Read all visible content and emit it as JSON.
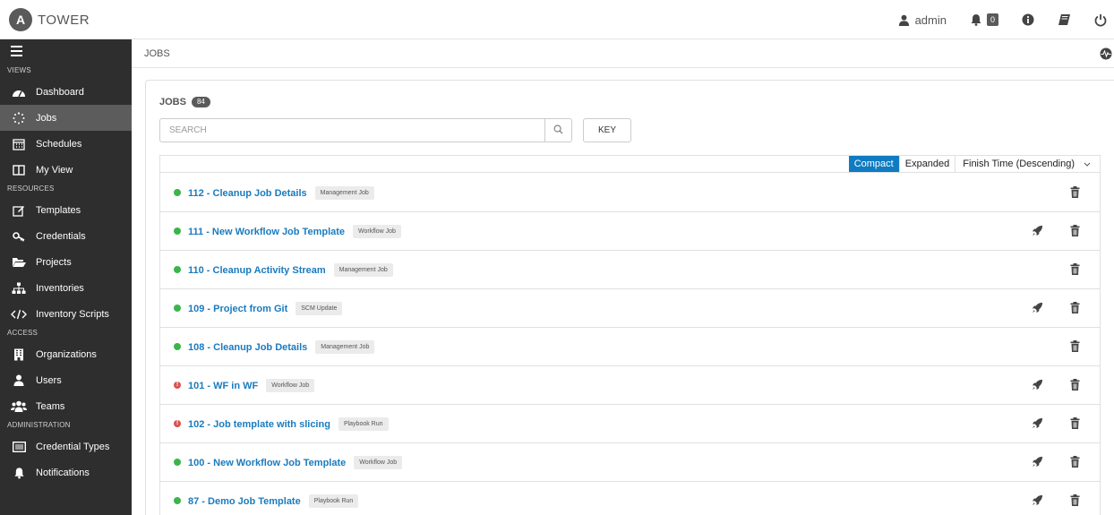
{
  "header": {
    "brand_letter": "A",
    "brand_name": "TOWER",
    "username": "admin",
    "notification_count": "0",
    "icons": [
      "user-icon",
      "bell-icon",
      "info-icon",
      "book-icon",
      "power-icon"
    ]
  },
  "sidebar": {
    "sections": [
      {
        "label": "VIEWS",
        "items": [
          {
            "label": "Dashboard",
            "icon": "dashboard-icon"
          },
          {
            "label": "Jobs",
            "icon": "spinner-icon",
            "active": true
          },
          {
            "label": "Schedules",
            "icon": "calendar-icon"
          },
          {
            "label": "My View",
            "icon": "columns-icon"
          }
        ]
      },
      {
        "label": "RESOURCES",
        "items": [
          {
            "label": "Templates",
            "icon": "pencil-square-icon"
          },
          {
            "label": "Credentials",
            "icon": "key-icon"
          },
          {
            "label": "Projects",
            "icon": "folder-open-icon"
          },
          {
            "label": "Inventories",
            "icon": "sitemap-icon"
          },
          {
            "label": "Inventory Scripts",
            "icon": "code-icon"
          }
        ]
      },
      {
        "label": "ACCESS",
        "items": [
          {
            "label": "Organizations",
            "icon": "building-icon"
          },
          {
            "label": "Users",
            "icon": "user-icon"
          },
          {
            "label": "Teams",
            "icon": "users-icon"
          }
        ]
      },
      {
        "label": "ADMINISTRATION",
        "items": [
          {
            "label": "Credential Types",
            "icon": "list-alt-icon"
          },
          {
            "label": "Notifications",
            "icon": "bell-icon"
          }
        ]
      }
    ]
  },
  "breadcrumb": {
    "current": "JOBS"
  },
  "panel": {
    "title": "JOBS",
    "count": "84",
    "search_placeholder": "SEARCH",
    "key_label": "KEY",
    "view_compact": "Compact",
    "view_expanded": "Expanded",
    "sort_label": "Finish Time (Descending)",
    "colors": {
      "accent": "#0f7bc2",
      "link": "#1a7bbf",
      "success": "#3bb54a",
      "failed": "#d9534f"
    }
  },
  "jobs": [
    {
      "name": "112 - Cleanup Job Details",
      "type": "Management Job",
      "status": "successful",
      "relaunch": false
    },
    {
      "name": "111 - New Workflow Job Template",
      "type": "Workflow Job",
      "status": "successful",
      "relaunch": true
    },
    {
      "name": "110 - Cleanup Activity Stream",
      "type": "Management Job",
      "status": "successful",
      "relaunch": false
    },
    {
      "name": "109 - Project from Git",
      "type": "SCM Update",
      "status": "successful",
      "relaunch": true
    },
    {
      "name": "108 - Cleanup Job Details",
      "type": "Management Job",
      "status": "successful",
      "relaunch": false
    },
    {
      "name": "101 - WF in WF",
      "type": "Workflow Job",
      "status": "failed",
      "relaunch": true
    },
    {
      "name": "102 - Job template with slicing",
      "type": "Playbook Run",
      "status": "failed",
      "relaunch": true
    },
    {
      "name": "100 - New Workflow Job Template",
      "type": "Workflow Job",
      "status": "successful",
      "relaunch": true
    },
    {
      "name": "87 - Demo Job Template",
      "type": "Playbook Run",
      "status": "successful",
      "relaunch": true
    }
  ]
}
